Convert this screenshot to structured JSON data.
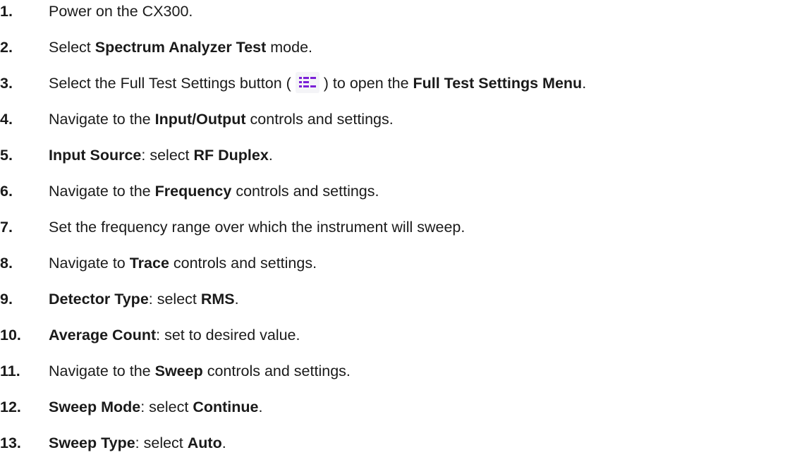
{
  "colors": {
    "text": "#1a1a1a",
    "icon": "#7a1fd6",
    "icon_bg": "#f4f4f7"
  },
  "steps": [
    {
      "num": "1.",
      "parts": [
        {
          "t": "Power on the CX300.",
          "b": false
        }
      ]
    },
    {
      "num": "2.",
      "parts": [
        {
          "t": "Select ",
          "b": false
        },
        {
          "t": "Spectrum Analyzer Test",
          "b": true
        },
        {
          "t": " mode.",
          "b": false
        }
      ]
    },
    {
      "num": "3.",
      "parts": [
        {
          "t": "Select the Full Test Settings button (",
          "b": false
        },
        {
          "icon": "full-test-settings-icon"
        },
        {
          "t": ") to open the ",
          "b": false
        },
        {
          "t": "Full Test Settings Menu",
          "b": true
        },
        {
          "t": ".",
          "b": false
        }
      ]
    },
    {
      "num": "4.",
      "parts": [
        {
          "t": "Navigate to the ",
          "b": false
        },
        {
          "t": "Input/Output",
          "b": true
        },
        {
          "t": " controls and settings.",
          "b": false
        }
      ]
    },
    {
      "num": "5.",
      "parts": [
        {
          "t": "Input Source",
          "b": true
        },
        {
          "t": ": select ",
          "b": false
        },
        {
          "t": "RF Duplex",
          "b": true
        },
        {
          "t": ".",
          "b": false
        }
      ]
    },
    {
      "num": "6.",
      "parts": [
        {
          "t": "Navigate to the ",
          "b": false
        },
        {
          "t": "Frequency",
          "b": true
        },
        {
          "t": " controls and settings.",
          "b": false
        }
      ]
    },
    {
      "num": "7.",
      "parts": [
        {
          "t": "Set the frequency range over which the instrument will sweep.",
          "b": false
        }
      ]
    },
    {
      "num": "8.",
      "parts": [
        {
          "t": "Navigate to ",
          "b": false
        },
        {
          "t": "Trace",
          "b": true
        },
        {
          "t": " controls and settings.",
          "b": false
        }
      ]
    },
    {
      "num": "9.",
      "parts": [
        {
          "t": "Detector Type",
          "b": true
        },
        {
          "t": ": select ",
          "b": false
        },
        {
          "t": "RMS",
          "b": true
        },
        {
          "t": ".",
          "b": false
        }
      ]
    },
    {
      "num": "10.",
      "parts": [
        {
          "t": "Average Count",
          "b": true
        },
        {
          "t": ": set to desired value.",
          "b": false
        }
      ]
    },
    {
      "num": "11.",
      "parts": [
        {
          "t": "Navigate to the ",
          "b": false
        },
        {
          "t": "Sweep",
          "b": true
        },
        {
          "t": " controls and settings.",
          "b": false
        }
      ]
    },
    {
      "num": "12.",
      "parts": [
        {
          "t": "Sweep Mode",
          "b": true
        },
        {
          "t": ": select ",
          "b": false
        },
        {
          "t": "Continue",
          "b": true
        },
        {
          "t": ".",
          "b": false
        }
      ]
    },
    {
      "num": "13.",
      "parts": [
        {
          "t": "Sweep Type",
          "b": true
        },
        {
          "t": ": select ",
          "b": false
        },
        {
          "t": "Auto",
          "b": true
        },
        {
          "t": ".",
          "b": false
        }
      ]
    }
  ]
}
